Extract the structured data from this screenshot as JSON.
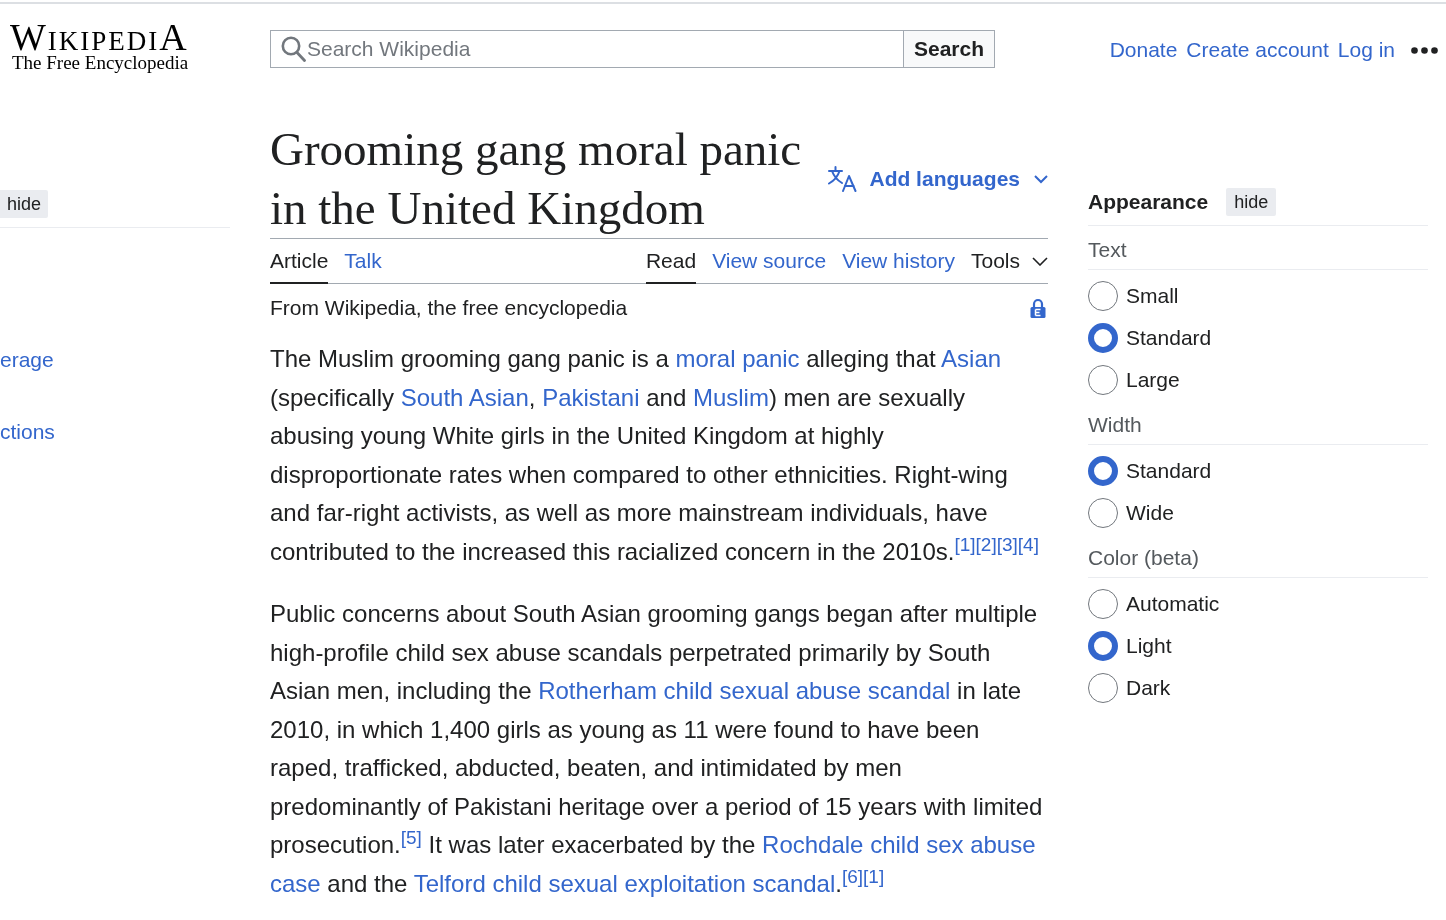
{
  "header": {
    "logo": {
      "wordmark": "WikipediA",
      "tagline": "The Free Encyclopedia"
    },
    "search": {
      "placeholder": "Search Wikipedia",
      "button": "Search"
    },
    "user_links": [
      "Donate",
      "Create account",
      "Log in"
    ]
  },
  "toc": {
    "hide_button": "hide",
    "items": [
      {
        "label": "erage"
      },
      {
        "label": "ctions"
      }
    ]
  },
  "article": {
    "title": "Grooming gang moral panic in the United Kingdom",
    "add_languages": "Add languages",
    "namespace_tabs": [
      {
        "label": "Article",
        "selected": true
      },
      {
        "label": "Talk",
        "selected": false
      }
    ],
    "view_tabs": [
      {
        "label": "Read",
        "selected": true
      },
      {
        "label": "View source",
        "selected": false
      },
      {
        "label": "View history",
        "selected": false
      }
    ],
    "tools": "Tools",
    "tagline": "From Wikipedia, the free encyclopedia",
    "paragraphs": [
      {
        "segments": [
          {
            "kind": "text",
            "text": "The Muslim grooming gang panic is a "
          },
          {
            "kind": "link",
            "text": "moral panic"
          },
          {
            "kind": "text",
            "text": " alleging that "
          },
          {
            "kind": "link",
            "text": "Asian"
          },
          {
            "kind": "text",
            "text": " (specifically "
          },
          {
            "kind": "link",
            "text": "South Asian"
          },
          {
            "kind": "text",
            "text": ", "
          },
          {
            "kind": "link",
            "text": "Pakistani"
          },
          {
            "kind": "text",
            "text": " and "
          },
          {
            "kind": "link",
            "text": "Muslim"
          },
          {
            "kind": "text",
            "text": ") men are sexually abusing young White girls in the United Kingdom at highly disproportionate rates when compared to other ethnicities. Right-wing and far-right activists, as well as more mainstream individuals, have contributed to the increased this racialized concern in the 2010s."
          },
          {
            "kind": "ref",
            "text": "[1]"
          },
          {
            "kind": "ref",
            "text": "[2]"
          },
          {
            "kind": "ref",
            "text": "[3]"
          },
          {
            "kind": "ref",
            "text": "[4]"
          }
        ]
      },
      {
        "segments": [
          {
            "kind": "text",
            "text": "Public concerns about South Asian grooming gangs began after multiple high-profile child sex abuse scandals perpetrated primarily by South Asian men, including the "
          },
          {
            "kind": "link",
            "text": "Rotherham child sexual abuse scandal"
          },
          {
            "kind": "text",
            "text": " in late 2010, in which 1,400 girls as young as 11 were found to have been raped, trafficked, abducted, beaten, and intimidated by men predominantly of Pakistani heritage over a period of 15 years with limited prosecution."
          },
          {
            "kind": "ref",
            "text": "[5]"
          },
          {
            "kind": "text",
            "text": " It was later exacerbated by the "
          },
          {
            "kind": "link",
            "text": "Rochdale child sex abuse "
          },
          {
            "kind": "link",
            "text": "case"
          },
          {
            "kind": "text",
            "text": " and the "
          },
          {
            "kind": "link",
            "text": "Telford child sexual exploitation scandal"
          },
          {
            "kind": "text",
            "text": "."
          },
          {
            "kind": "ref",
            "text": "[6]"
          },
          {
            "kind": "ref",
            "text": "[1]"
          }
        ]
      }
    ]
  },
  "appearance": {
    "title": "Appearance",
    "hide_button": "hide",
    "sections": [
      {
        "heading": "Text",
        "options": [
          {
            "label": "Small",
            "selected": false
          },
          {
            "label": "Standard",
            "selected": true
          },
          {
            "label": "Large",
            "selected": false
          }
        ]
      },
      {
        "heading": "Width",
        "options": [
          {
            "label": "Standard",
            "selected": true
          },
          {
            "label": "Wide",
            "selected": false
          }
        ]
      },
      {
        "heading": "Color (beta)",
        "options": [
          {
            "label": "Automatic",
            "selected": false
          },
          {
            "label": "Light",
            "selected": true
          },
          {
            "label": "Dark",
            "selected": false
          }
        ]
      }
    ]
  }
}
